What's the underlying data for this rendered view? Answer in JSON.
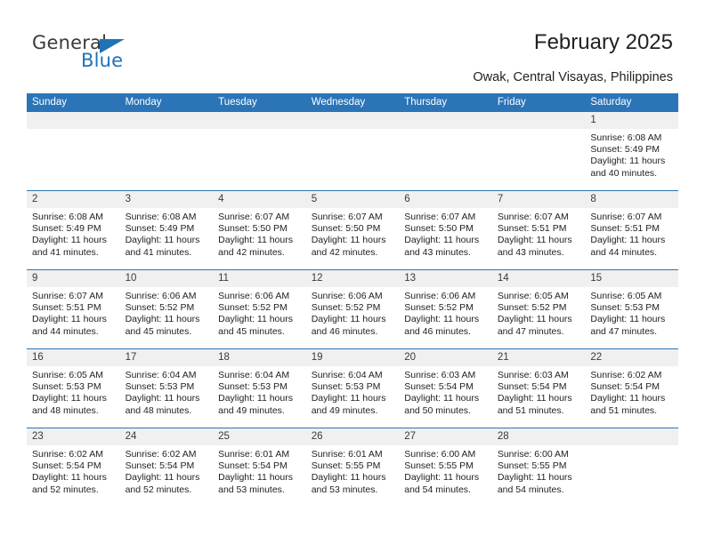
{
  "logo": {
    "word_top": "General",
    "word_bottom": "Blue",
    "triangle_icon": "triangle-icon",
    "color_blue": "#1f72b8",
    "color_dark": "#3b3b3b"
  },
  "header": {
    "title": "February 2025",
    "subtitle": "Owak, Central Visayas, Philippines"
  },
  "calendar": {
    "header_bg": "#2b74b8",
    "daynum_bg": "#f0f0f0",
    "weekday_headers": [
      "Sunday",
      "Monday",
      "Tuesday",
      "Wednesday",
      "Thursday",
      "Friday",
      "Saturday"
    ],
    "weeks": [
      [
        {
          "day": "",
          "lines": []
        },
        {
          "day": "",
          "lines": []
        },
        {
          "day": "",
          "lines": []
        },
        {
          "day": "",
          "lines": []
        },
        {
          "day": "",
          "lines": []
        },
        {
          "day": "",
          "lines": []
        },
        {
          "day": "1",
          "lines": [
            "Sunrise: 6:08 AM",
            "Sunset: 5:49 PM",
            "Daylight: 11 hours",
            "and 40 minutes."
          ]
        }
      ],
      [
        {
          "day": "2",
          "lines": [
            "Sunrise: 6:08 AM",
            "Sunset: 5:49 PM",
            "Daylight: 11 hours",
            "and 41 minutes."
          ]
        },
        {
          "day": "3",
          "lines": [
            "Sunrise: 6:08 AM",
            "Sunset: 5:49 PM",
            "Daylight: 11 hours",
            "and 41 minutes."
          ]
        },
        {
          "day": "4",
          "lines": [
            "Sunrise: 6:07 AM",
            "Sunset: 5:50 PM",
            "Daylight: 11 hours",
            "and 42 minutes."
          ]
        },
        {
          "day": "5",
          "lines": [
            "Sunrise: 6:07 AM",
            "Sunset: 5:50 PM",
            "Daylight: 11 hours",
            "and 42 minutes."
          ]
        },
        {
          "day": "6",
          "lines": [
            "Sunrise: 6:07 AM",
            "Sunset: 5:50 PM",
            "Daylight: 11 hours",
            "and 43 minutes."
          ]
        },
        {
          "day": "7",
          "lines": [
            "Sunrise: 6:07 AM",
            "Sunset: 5:51 PM",
            "Daylight: 11 hours",
            "and 43 minutes."
          ]
        },
        {
          "day": "8",
          "lines": [
            "Sunrise: 6:07 AM",
            "Sunset: 5:51 PM",
            "Daylight: 11 hours",
            "and 44 minutes."
          ]
        }
      ],
      [
        {
          "day": "9",
          "lines": [
            "Sunrise: 6:07 AM",
            "Sunset: 5:51 PM",
            "Daylight: 11 hours",
            "and 44 minutes."
          ]
        },
        {
          "day": "10",
          "lines": [
            "Sunrise: 6:06 AM",
            "Sunset: 5:52 PM",
            "Daylight: 11 hours",
            "and 45 minutes."
          ]
        },
        {
          "day": "11",
          "lines": [
            "Sunrise: 6:06 AM",
            "Sunset: 5:52 PM",
            "Daylight: 11 hours",
            "and 45 minutes."
          ]
        },
        {
          "day": "12",
          "lines": [
            "Sunrise: 6:06 AM",
            "Sunset: 5:52 PM",
            "Daylight: 11 hours",
            "and 46 minutes."
          ]
        },
        {
          "day": "13",
          "lines": [
            "Sunrise: 6:06 AM",
            "Sunset: 5:52 PM",
            "Daylight: 11 hours",
            "and 46 minutes."
          ]
        },
        {
          "day": "14",
          "lines": [
            "Sunrise: 6:05 AM",
            "Sunset: 5:52 PM",
            "Daylight: 11 hours",
            "and 47 minutes."
          ]
        },
        {
          "day": "15",
          "lines": [
            "Sunrise: 6:05 AM",
            "Sunset: 5:53 PM",
            "Daylight: 11 hours",
            "and 47 minutes."
          ]
        }
      ],
      [
        {
          "day": "16",
          "lines": [
            "Sunrise: 6:05 AM",
            "Sunset: 5:53 PM",
            "Daylight: 11 hours",
            "and 48 minutes."
          ]
        },
        {
          "day": "17",
          "lines": [
            "Sunrise: 6:04 AM",
            "Sunset: 5:53 PM",
            "Daylight: 11 hours",
            "and 48 minutes."
          ]
        },
        {
          "day": "18",
          "lines": [
            "Sunrise: 6:04 AM",
            "Sunset: 5:53 PM",
            "Daylight: 11 hours",
            "and 49 minutes."
          ]
        },
        {
          "day": "19",
          "lines": [
            "Sunrise: 6:04 AM",
            "Sunset: 5:53 PM",
            "Daylight: 11 hours",
            "and 49 minutes."
          ]
        },
        {
          "day": "20",
          "lines": [
            "Sunrise: 6:03 AM",
            "Sunset: 5:54 PM",
            "Daylight: 11 hours",
            "and 50 minutes."
          ]
        },
        {
          "day": "21",
          "lines": [
            "Sunrise: 6:03 AM",
            "Sunset: 5:54 PM",
            "Daylight: 11 hours",
            "and 51 minutes."
          ]
        },
        {
          "day": "22",
          "lines": [
            "Sunrise: 6:02 AM",
            "Sunset: 5:54 PM",
            "Daylight: 11 hours",
            "and 51 minutes."
          ]
        }
      ],
      [
        {
          "day": "23",
          "lines": [
            "Sunrise: 6:02 AM",
            "Sunset: 5:54 PM",
            "Daylight: 11 hours",
            "and 52 minutes."
          ]
        },
        {
          "day": "24",
          "lines": [
            "Sunrise: 6:02 AM",
            "Sunset: 5:54 PM",
            "Daylight: 11 hours",
            "and 52 minutes."
          ]
        },
        {
          "day": "25",
          "lines": [
            "Sunrise: 6:01 AM",
            "Sunset: 5:54 PM",
            "Daylight: 11 hours",
            "and 53 minutes."
          ]
        },
        {
          "day": "26",
          "lines": [
            "Sunrise: 6:01 AM",
            "Sunset: 5:55 PM",
            "Daylight: 11 hours",
            "and 53 minutes."
          ]
        },
        {
          "day": "27",
          "lines": [
            "Sunrise: 6:00 AM",
            "Sunset: 5:55 PM",
            "Daylight: 11 hours",
            "and 54 minutes."
          ]
        },
        {
          "day": "28",
          "lines": [
            "Sunrise: 6:00 AM",
            "Sunset: 5:55 PM",
            "Daylight: 11 hours",
            "and 54 minutes."
          ]
        },
        {
          "day": "",
          "lines": []
        }
      ]
    ]
  }
}
